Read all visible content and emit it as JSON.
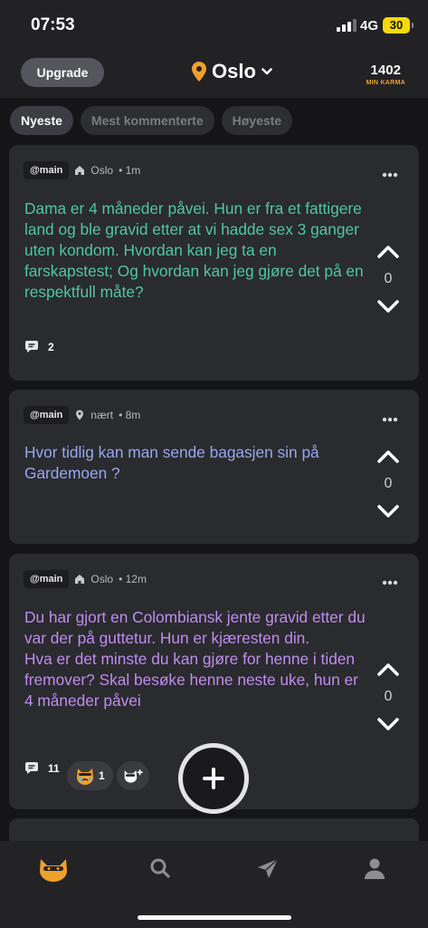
{
  "status": {
    "time": "07:53",
    "network": "4G",
    "battery": "30"
  },
  "header": {
    "upgrade_label": "Upgrade",
    "city": "Oslo",
    "karma_value": "1402",
    "karma_label": "MIN KARMA"
  },
  "tabs": [
    {
      "label": "Nyeste",
      "active": true
    },
    {
      "label": "Mest kommenterte",
      "active": false
    },
    {
      "label": "Høyeste",
      "active": false
    }
  ],
  "posts": [
    {
      "channel": "@main",
      "location": "Oslo",
      "location_icon": "house-icon",
      "time": "• 1m",
      "text": "Dama er 4 måneder påvei. Hun er fra et fattigere land og ble gravid etter at vi hadde sex 3 ganger uten kondom. Hvordan kan jeg ta en farskapstest; Og hvordan kan jeg gjøre det på en respektfull måte?",
      "color": "#4fc7a3",
      "votes": "0",
      "comments": "2"
    },
    {
      "channel": "@main",
      "location": "nært",
      "location_icon": "location-pin-icon",
      "time": "• 8m",
      "text": "Hvor tidlig kan man sende bagasjen sin på Gardemoen ?",
      "color": "#9aa6ee",
      "votes": "0"
    },
    {
      "channel": "@main",
      "location": "Oslo",
      "location_icon": "house-icon",
      "time": "• 12m",
      "text_line1": "Du har gjort en Colombiansk jente gravid etter du var der på guttetur. Hun er kjæresten din.",
      "text_line2": "Hva er det minste du kan gjøre for henne i tiden fremover? Skal besøke henne neste uke, hun er 4 måneder påvei",
      "color": "#c18cf0",
      "votes": "0",
      "comments": "11",
      "reaction_count": "1"
    }
  ],
  "nav": [
    "cat-mascot-icon",
    "search-icon",
    "send-icon",
    "profile-icon"
  ],
  "colors": {
    "accent": "#f0a02d",
    "background": "#151517",
    "card": "#2a2b2e"
  }
}
